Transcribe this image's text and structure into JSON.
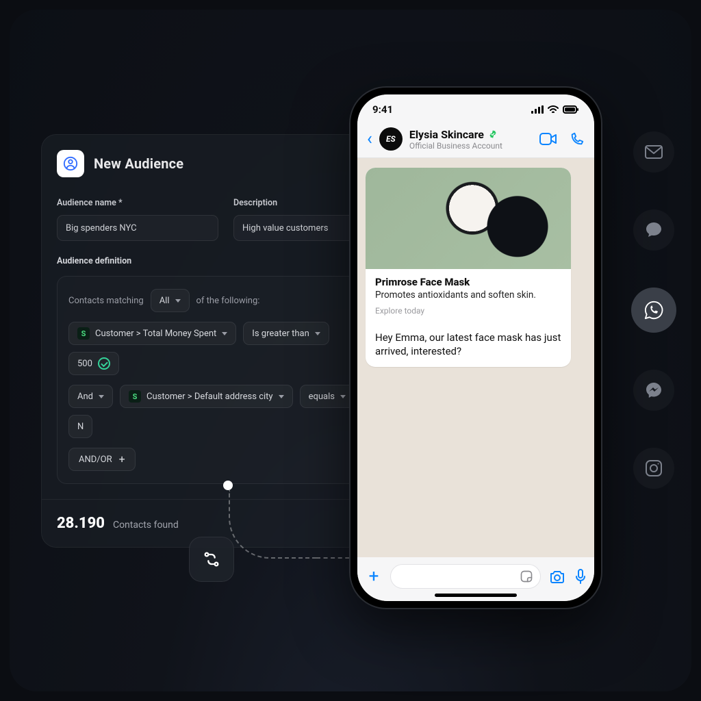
{
  "audience": {
    "title": "New Audience",
    "name_label": "Audience name *",
    "name_value": "Big spenders NYC",
    "desc_label": "Description",
    "desc_value": "High value customers",
    "definition_label": "Audience definition",
    "matching_pre": "Contacts matching",
    "matching_mode": "All",
    "matching_post": "of the following:",
    "rule1": {
      "attr": "Customer > Total Money Spent",
      "op": "Is greater than",
      "val": "500"
    },
    "rule2": {
      "join": "And",
      "attr": "Customer > Default address city",
      "op": "equals",
      "val": "N"
    },
    "andor": "AND/OR",
    "contacts_count": "28.190",
    "contacts_label": "Contacts found"
  },
  "phone": {
    "time": "9:41",
    "chat_name": "Elysia Skincare",
    "chat_sub": "Official Business Account",
    "card_title": "Primrose Face Mask",
    "card_desc": "Promotes antioxidants and soften skin.",
    "card_cta": "Explore today",
    "message": "Hey Emma, our latest face mask has just arrived, interested?",
    "avatar_initials": "ES"
  },
  "rail": {
    "items": [
      "email",
      "sms",
      "whatsapp",
      "messenger",
      "instagram"
    ],
    "active": "whatsapp"
  }
}
